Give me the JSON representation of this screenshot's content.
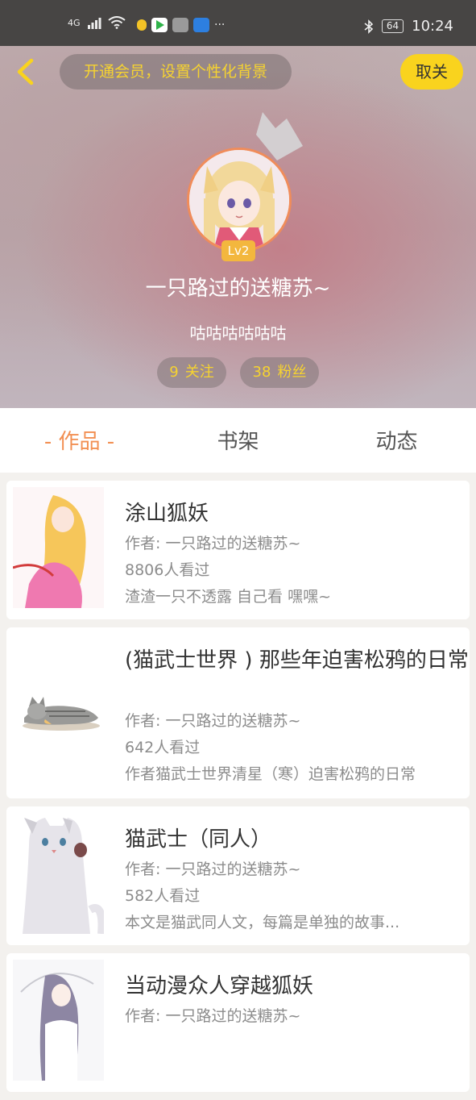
{
  "status_bar": {
    "network": "4G",
    "battery": "64",
    "time": "10:24",
    "more": "···"
  },
  "header": {
    "vip_prompt": "开通会员，设置个性化背景",
    "cancel_label": "取关",
    "level": "Lv2",
    "nickname": "一只路过的送糖苏~",
    "signature": "咕咕咕咕咕咕",
    "following_count": "9",
    "following_label": "关注",
    "fans_count": "38",
    "fans_label": "粉丝"
  },
  "tabs": [
    {
      "label": "- 作品 -",
      "active": true
    },
    {
      "label": "书架",
      "active": false
    },
    {
      "label": "动态",
      "active": false
    }
  ],
  "works": [
    {
      "title": "涂山狐妖",
      "author": "作者: 一只路过的送糖苏~",
      "views": "8806人看过",
      "desc": "渣渣一只不透露 自己看 嘿嘿~"
    },
    {
      "title": "(猫武士世界 ) 那些年迫害松鸦的日常",
      "author": "作者: 一只路过的送糖苏~",
      "views": "642人看过",
      "desc": "作者猫武士世界清星（寒）迫害松鸦的日常"
    },
    {
      "title": "猫武士（同人）",
      "author": "作者: 一只路过的送糖苏~",
      "views": "582人看过",
      "desc": "本文是猫武同人文，每篇是单独的故事..."
    },
    {
      "title": "当动漫众人穿越狐妖",
      "author": "作者: 一只路过的送糖苏~",
      "views": "",
      "desc": ""
    }
  ]
}
